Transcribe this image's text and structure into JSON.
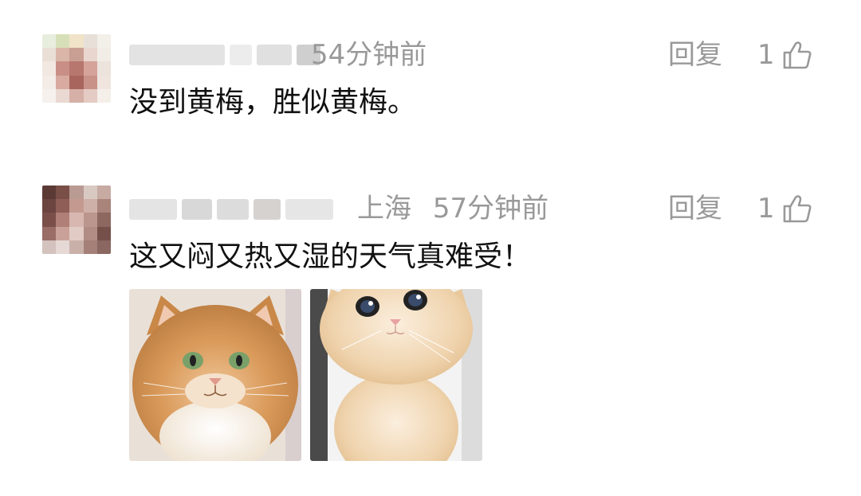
{
  "comments": [
    {
      "time": "54分钟前",
      "location": "",
      "reply_label": "回复",
      "like_count": "1",
      "text": "没到黄梅，胜似黄梅。",
      "avatar": "pixelated-avatar",
      "username_obscured": true
    },
    {
      "time": "57分钟前",
      "location": "上海",
      "reply_label": "回复",
      "like_count": "1",
      "text": "这又闷又热又湿的天气真难受！",
      "avatar": "pixelated-avatar",
      "username_obscured": true,
      "images": [
        {
          "subject": "orange-tabby-cat-photo"
        },
        {
          "subject": "cream-kitten-photo"
        }
      ]
    }
  ],
  "icons": {
    "like": "thumbs-up-icon"
  },
  "colors": {
    "meta": "#999999",
    "text": "#111111",
    "background": "#ffffff"
  }
}
